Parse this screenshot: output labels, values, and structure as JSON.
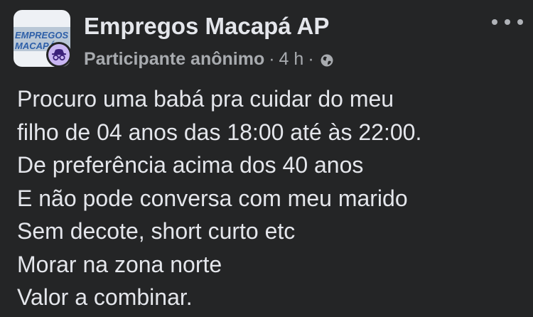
{
  "group": {
    "name": "Empregos Macapá AP",
    "avatar_logo_line1": "EMPREGOS",
    "avatar_logo_line2": "MACAPÁ",
    "badge_icon": "anonymous-incognito-icon"
  },
  "meta": {
    "author": "Participante anônimo",
    "separator": "·",
    "time": "4 h",
    "privacy_icon": "globe-icon"
  },
  "menu": {
    "more_icon": "more-horizontal-icon"
  },
  "post": {
    "lines": [
      "Procuro uma babá pra cuidar do meu",
      "filho de 04 anos das 18:00 até às 22:00.",
      "De preferência acima dos 40 anos",
      "E não pode conversa com meu marido",
      "Sem decote, short curto etc",
      "Morar na zona norte",
      "Valor a combinar."
    ]
  },
  "colors": {
    "background": "#242526",
    "primary_text": "#e4e6eb",
    "secondary_text": "#a8abaf",
    "badge": "#c9b6f2",
    "logo_blue": "#2d5fa8"
  }
}
